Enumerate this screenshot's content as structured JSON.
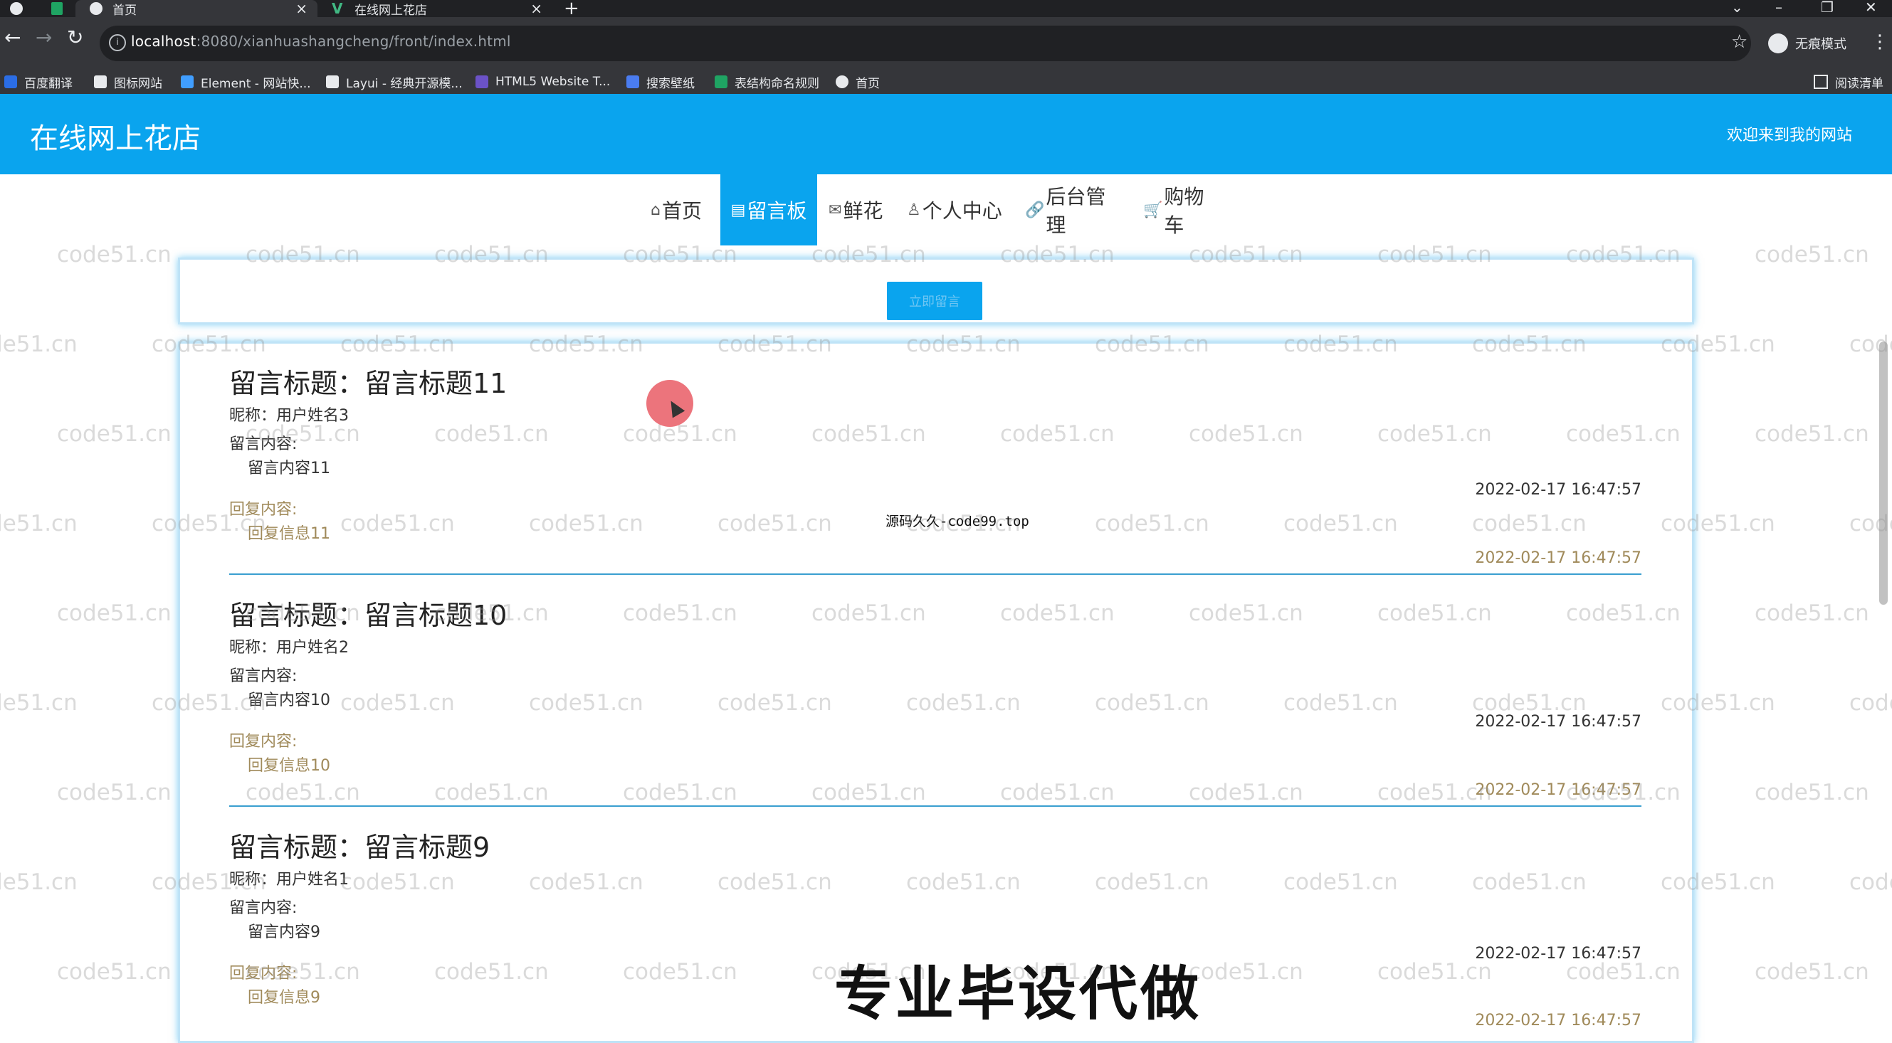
{
  "browser": {
    "tabs": [
      {
        "label": "首页",
        "active": true
      },
      {
        "label": "在线网上花店",
        "active": false
      }
    ],
    "new_tab": "+",
    "url_host": "localhost",
    "url_path": ":8080/xianhuashangcheng/front/index.html",
    "incognito_label": "无痕模式",
    "bookmarks": [
      {
        "label": "百度翻译",
        "icon": "baidu-translate-icon",
        "color": "#2b6de5"
      },
      {
        "label": "图标网站",
        "icon": "flag-icon",
        "color": "#e8eaed"
      },
      {
        "label": "Element - 网站快...",
        "icon": "element-icon",
        "color": "#409eff"
      },
      {
        "label": "Layui - 经典开源模...",
        "icon": "layui-icon",
        "color": "#e8eaed"
      },
      {
        "label": "HTML5 Website T...",
        "icon": "html5-icon",
        "color": "#6b52c7"
      },
      {
        "label": "搜索壁纸",
        "icon": "wallpaper-icon",
        "color": "#4a7cf0"
      },
      {
        "label": "表结构命名规则",
        "icon": "sheet-icon",
        "color": "#1fa463"
      },
      {
        "label": "首页",
        "icon": "globe-icon",
        "color": "#e8eaed"
      }
    ],
    "reading_list": "阅读清单"
  },
  "site": {
    "title": "在线网上花店",
    "welcome": "欢迎来到我的网站"
  },
  "nav": [
    {
      "icon": "⌂",
      "label": "首页",
      "active": false
    },
    {
      "icon": "▤",
      "label": "留言板",
      "active": true
    },
    {
      "icon": "✉",
      "label": "鲜花",
      "active": false
    },
    {
      "icon": "♙",
      "label": "个人中心",
      "active": false
    },
    {
      "icon": "🔗",
      "label": "后台管理",
      "active": false
    },
    {
      "icon": "🛒",
      "label": "购物车",
      "active": false
    }
  ],
  "post_button": "立即留言",
  "messages": [
    {
      "title": "留言标题：留言标题11",
      "nickname": "昵称：用户姓名3",
      "content_label": "留言内容:",
      "content": "留言内容11",
      "content_time": "2022-02-17 16:47:57",
      "reply_label": "回复内容:",
      "reply": "回复信息11",
      "reply_time": "2022-02-17 16:47:57"
    },
    {
      "title": "留言标题：留言标题10",
      "nickname": "昵称：用户姓名2",
      "content_label": "留言内容:",
      "content": "留言内容10",
      "content_time": "2022-02-17 16:47:57",
      "reply_label": "回复内容:",
      "reply": "回复信息10",
      "reply_time": "2022-02-17 16:47:57"
    },
    {
      "title": "留言标题：留言标题9",
      "nickname": "昵称：用户姓名1",
      "content_label": "留言内容:",
      "content": "留言内容9",
      "content_time": "2022-02-17 16:47:57",
      "reply_label": "回复内容:",
      "reply": "回复信息9",
      "reply_time": "2022-02-17 16:47:57"
    }
  ],
  "overlays": {
    "watermark": "code51.cn",
    "center_mark": "源码久久-code99.top",
    "stamp": "专业毕设代做"
  },
  "colors": {
    "brand": "#0aa4ee",
    "reply": "#a08a5a"
  }
}
